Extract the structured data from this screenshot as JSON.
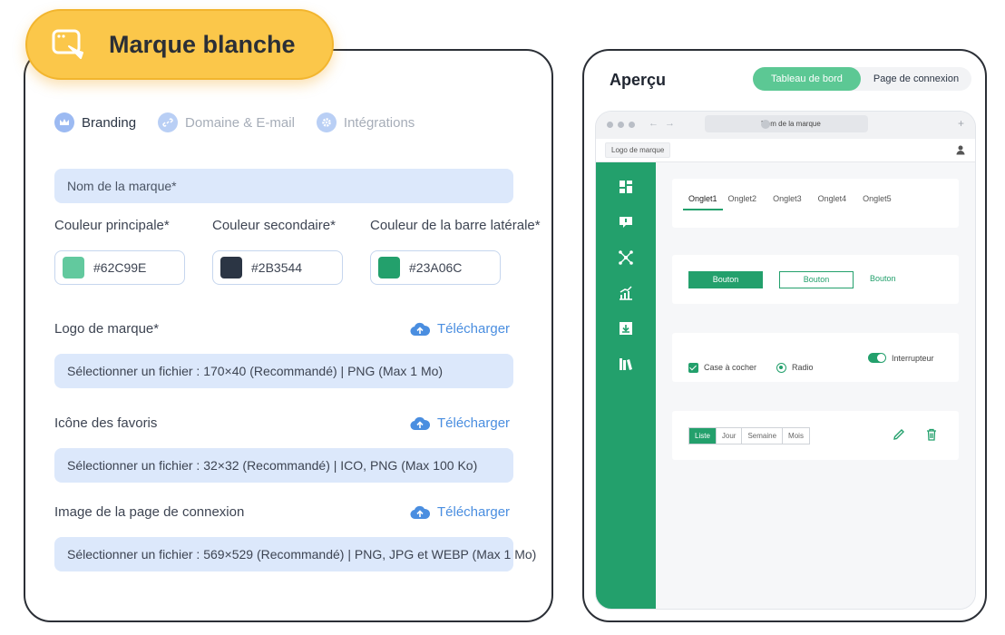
{
  "left": {
    "title": "Marque blanche",
    "tabs": [
      {
        "label": "Branding",
        "active": true
      },
      {
        "label": "Domaine & E-mail",
        "active": false
      },
      {
        "label": "Intégrations",
        "active": false
      }
    ],
    "brand_name_placeholder": "Nom de la marque*",
    "colors": [
      {
        "label": "Couleur principale*",
        "hex": "#62C99E",
        "swatch": "#62C99E"
      },
      {
        "label": "Couleur secondaire*",
        "hex": "#2B3544",
        "swatch": "#2B3544"
      },
      {
        "label": "Couleur de la barre latérale*",
        "hex": "#23A06C",
        "swatch": "#23A06C"
      }
    ],
    "files": [
      {
        "label": "Logo de marque*",
        "upload": "Télécharger",
        "field": "Sélectionner un fichier : 170×40 (Recommandé) | PNG (Max 1 Mo)"
      },
      {
        "label": "Icône des favoris",
        "upload": "Télécharger",
        "field": "Sélectionner un fichier : 32×32 (Recommandé) | ICO, PNG (Max 100 Ko)"
      },
      {
        "label": "Image de la page de connexion",
        "upload": "Télécharger",
        "field": "Sélectionner un fichier : 569×529 (Recommandé) | PNG, JPG et WEBP (Max 1 Mo)"
      }
    ]
  },
  "right": {
    "title": "Aperçu",
    "segments": [
      {
        "label": "Tableau de bord",
        "active": true
      },
      {
        "label": "Page de connexion",
        "active": false
      }
    ],
    "browser": {
      "url_text": "Nom de la marque",
      "logo_text": "Logo de marque"
    },
    "sidebar_icons": [
      "dashboard-icon",
      "chat-icon",
      "network-icon",
      "chart-icon",
      "download-icon",
      "library-icon"
    ],
    "preview_tabs": [
      "Onglet1",
      "Onglet2",
      "Onglet3",
      "Onglet4",
      "Onglet5"
    ],
    "buttons": [
      "Bouton",
      "Bouton",
      "Bouton"
    ],
    "controls": {
      "checkbox": "Case à cocher",
      "radio": "Radio",
      "toggle": "Interrupteur"
    },
    "button_group": [
      "Liste",
      "Jour",
      "Semaine",
      "Mois"
    ]
  },
  "theme": {
    "primary": "#62C99E",
    "secondary": "#2B3544",
    "sidebar": "#23A06C",
    "badge": "#FBC74A",
    "link": "#4A8EE0",
    "field_bg": "#DCE8FB"
  }
}
